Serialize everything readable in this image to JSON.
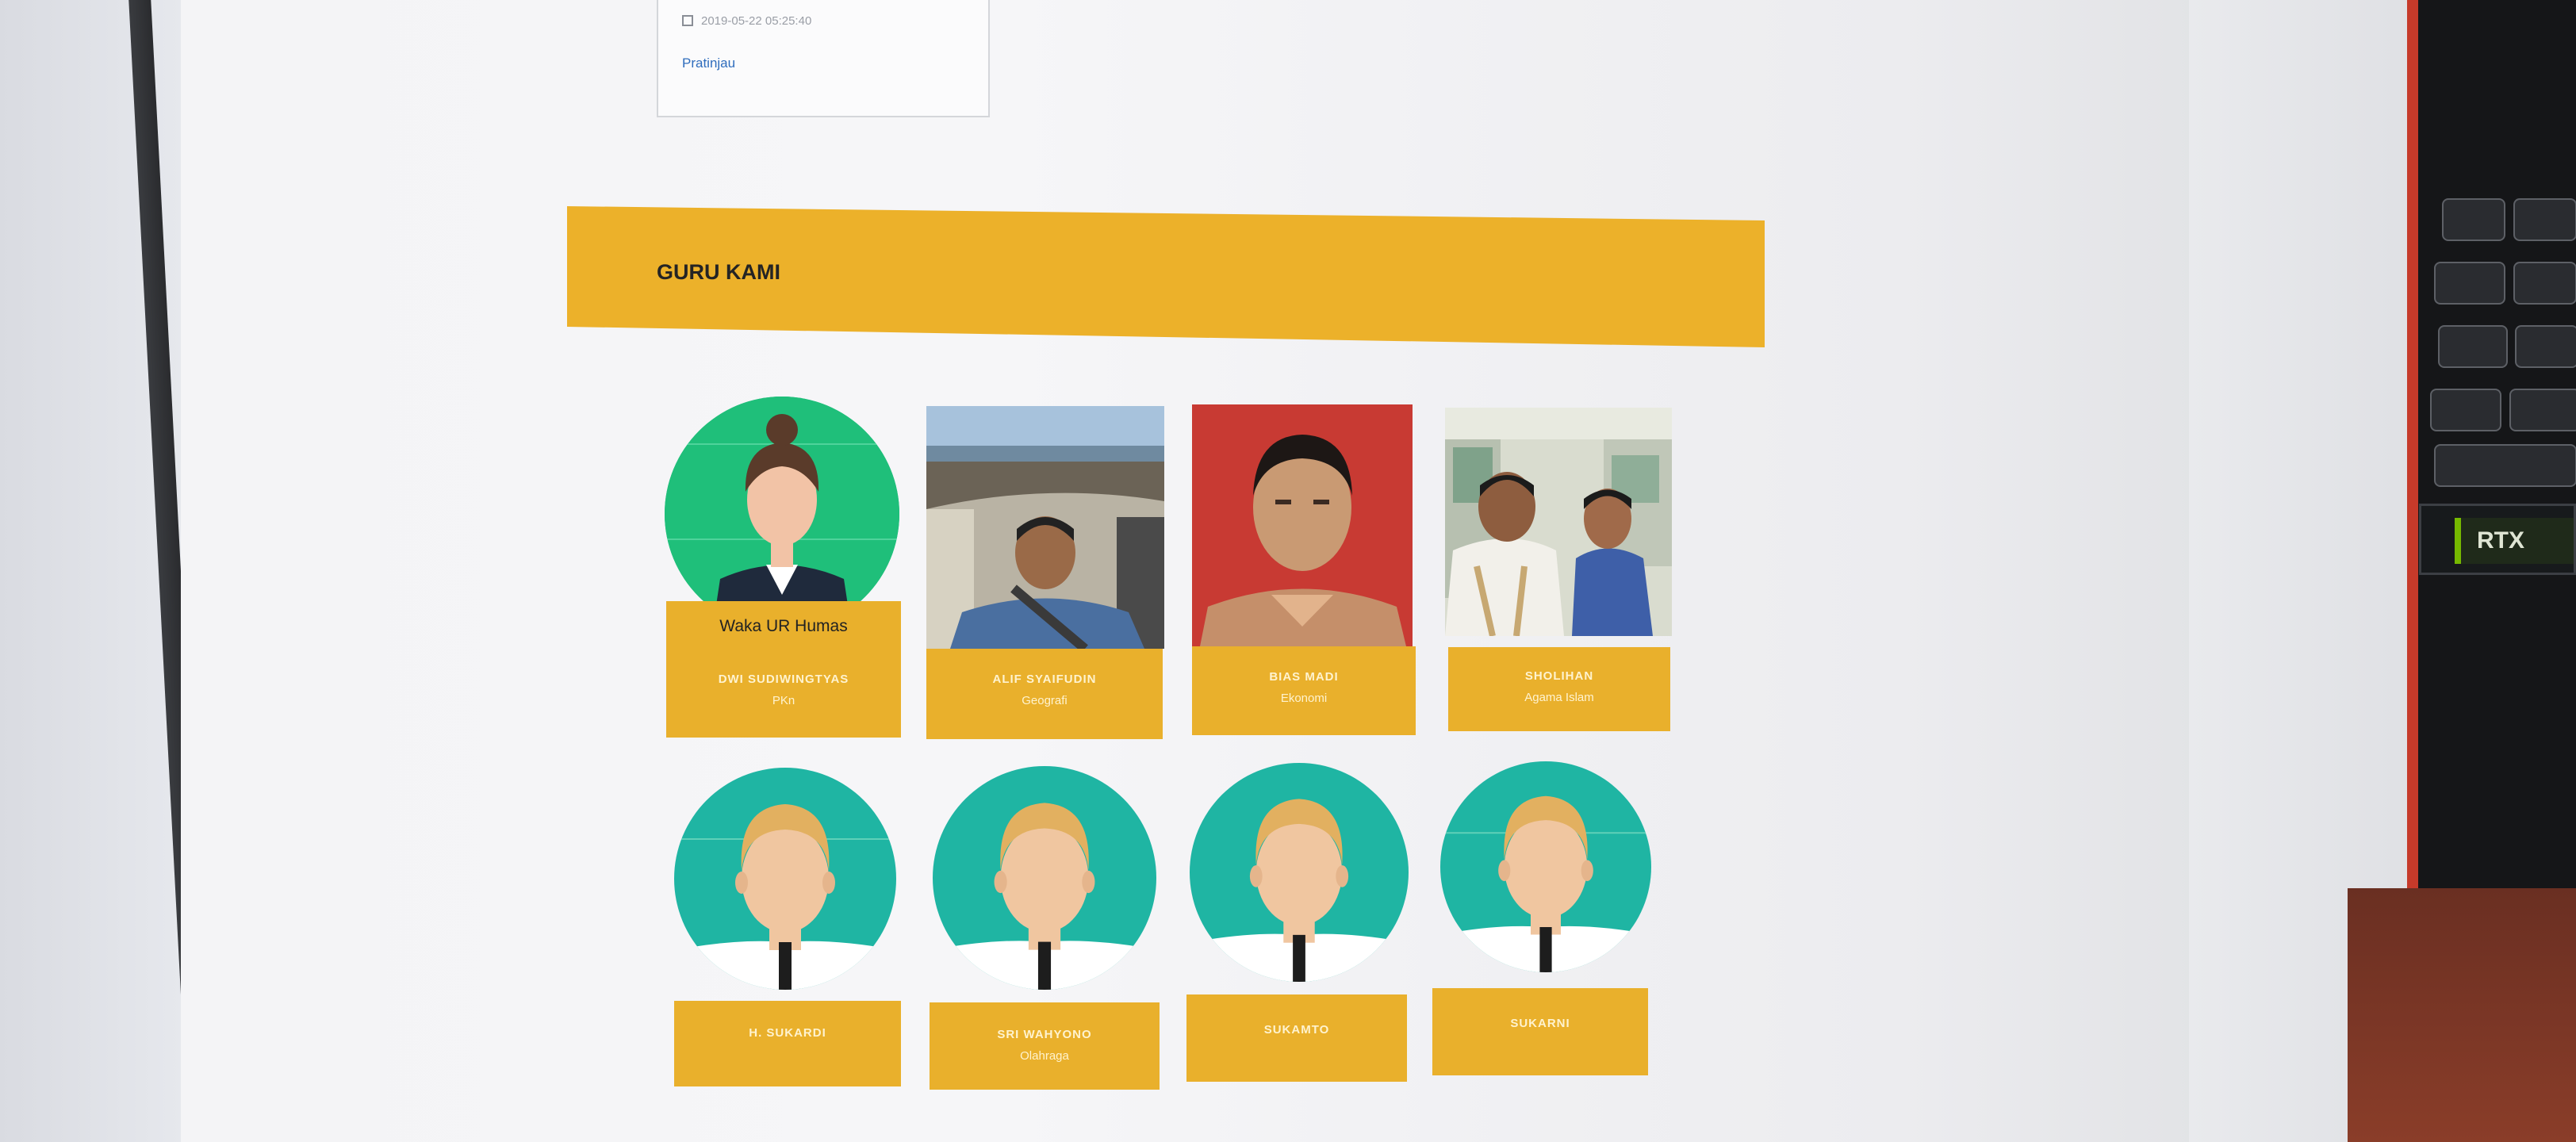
{
  "news_card": {
    "date": "2019-05-22 05:25:40",
    "link": "Pratinjau"
  },
  "section": {
    "title": "GURU KAMI"
  },
  "teachers": [
    {
      "name": "DWI SUDIWINGTYAS",
      "role": "PKn",
      "extra": "Waka UR Humas",
      "photo": "avatar-female-icon"
    },
    {
      "name": "ALIF SYAIFUDIN",
      "role": "Geografi",
      "photo": "photo-man-in-car"
    },
    {
      "name": "BIAS MADI",
      "role": "Ekonomi",
      "photo": "photo-man-red-background"
    },
    {
      "name": "SHOLIHAN",
      "role": "Agama Islam",
      "photo": "photo-two-men"
    },
    {
      "name": "H. SUKARDI",
      "role": "",
      "photo": "avatar-male-icon"
    },
    {
      "name": "SRI WAHYONO",
      "role": "Olahraga",
      "photo": "avatar-male-icon"
    },
    {
      "name": "SUKAMTO",
      "role": "",
      "photo": "avatar-male-icon"
    },
    {
      "name": "SUKARNI",
      "role": "",
      "photo": "avatar-male-icon"
    }
  ],
  "colors": {
    "accent": "#ecb12a",
    "avatar_female_bg": "#1fbf7a",
    "avatar_male_bg": "#1fb5a3",
    "page": "#f4f4f6"
  },
  "laptop_sticker": "RTX"
}
